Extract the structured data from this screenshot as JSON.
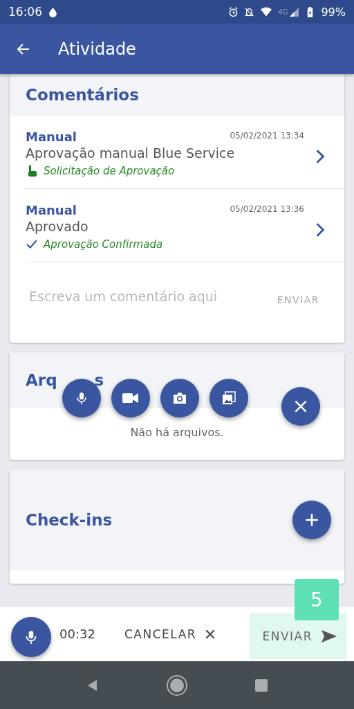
{
  "status_bar": {
    "time": "16:06",
    "network": "4G",
    "battery": "99%"
  },
  "app_bar": {
    "title": "Atividade"
  },
  "comments": {
    "title": "Comentários",
    "items": [
      {
        "author": "Manual",
        "date": "05/02/2021 13:34",
        "text": "Aprovação manual Blue Service",
        "status": "Solicitação de Aprovação",
        "kind": "hand"
      },
      {
        "author": "Manual",
        "date": "05/02/2021 13:36",
        "text": "Aprovado",
        "status": "Aprovação Confirmada",
        "kind": "check"
      }
    ],
    "input": {
      "placeholder": "Escreva um comentário aqui"
    },
    "send": "ENVIAR"
  },
  "files": {
    "title_parts": [
      "Arq",
      "s"
    ],
    "empty": "Não há arquivos."
  },
  "attach_menu": {
    "actions": [
      {
        "kind": "mic"
      },
      {
        "kind": "video"
      },
      {
        "kind": "camera"
      },
      {
        "kind": "gallery"
      }
    ]
  },
  "checkins": {
    "title": "Check-ins"
  },
  "recorder": {
    "duration": "00:32",
    "cancel": "CANCELAR",
    "send": "ENVIAR",
    "count": "5"
  }
}
